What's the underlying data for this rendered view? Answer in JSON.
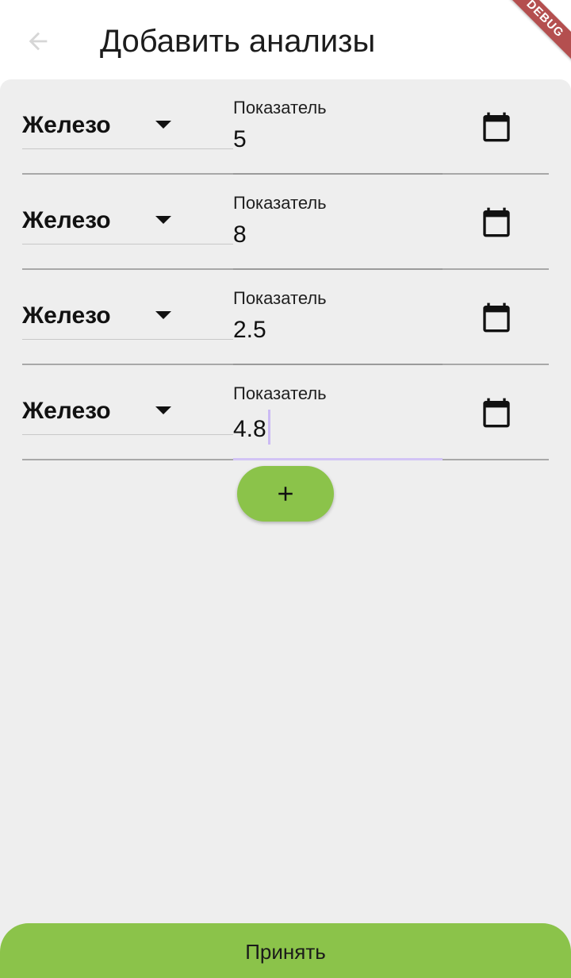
{
  "app_bar": {
    "title": "Добавить анализы",
    "back_icon": "arrow-back-icon"
  },
  "debug_banner": "DEBUG",
  "rows": [
    {
      "test_type": "Железо",
      "field_label": "Показатель",
      "value": "5",
      "calendar_icon": "calendar-icon"
    },
    {
      "test_type": "Железо",
      "field_label": "Показатель",
      "value": "8",
      "calendar_icon": "calendar-icon"
    },
    {
      "test_type": "Железо",
      "field_label": "Показатель",
      "value": "2.5",
      "calendar_icon": "calendar-icon"
    },
    {
      "test_type": "Железо",
      "field_label": "Показатель",
      "value": "4.8",
      "calendar_icon": "calendar-icon",
      "focused": true
    }
  ],
  "add_button": {
    "icon": "plus-icon"
  },
  "submit_button": {
    "label": "Принять"
  },
  "colors": {
    "accent_green": "#8bc34a",
    "background": "#eeeeee",
    "focus_underline": "#d2c4f5",
    "debug_ribbon": "#b44f4f"
  }
}
